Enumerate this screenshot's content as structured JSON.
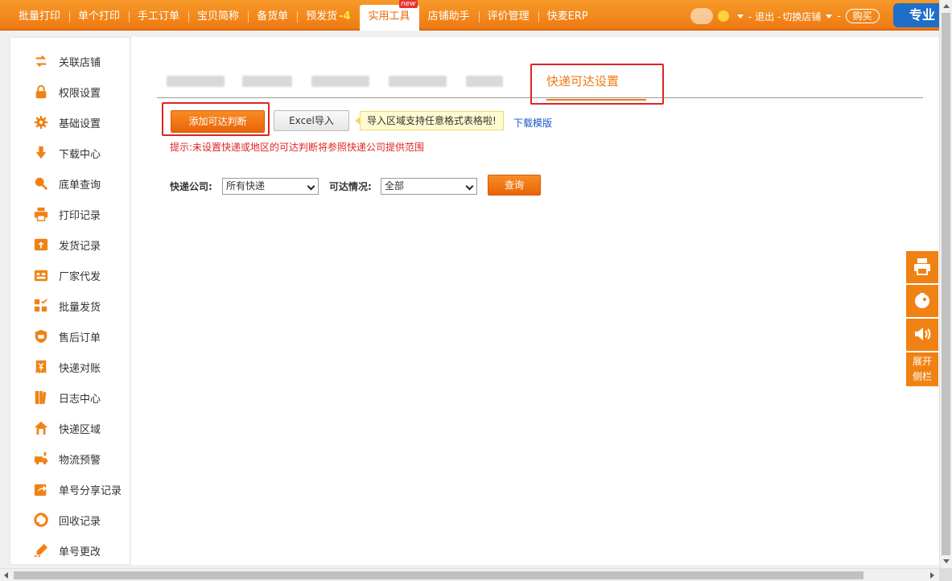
{
  "nav": {
    "items": [
      "批量打印",
      "单个打印",
      "手工订单",
      "宝贝简称",
      "备货单",
      "预发货",
      "实用工具",
      "店铺助手",
      "评价管理",
      "快麦ERP"
    ],
    "badge": "-4",
    "new_label": "new",
    "active_index": 6
  },
  "user": {
    "logout": "- 退出 -",
    "switch_shop": "切换店铺",
    "sep": "-",
    "buy": "购买",
    "pro": "专业"
  },
  "sidebar": {
    "items": [
      {
        "label": "关联店铺",
        "icon": "swap-icon"
      },
      {
        "label": "权限设置",
        "icon": "lock-icon"
      },
      {
        "label": "基础设置",
        "icon": "gear-icon"
      },
      {
        "label": "下载中心",
        "icon": "download-icon"
      },
      {
        "label": "底单查询",
        "icon": "search-icon"
      },
      {
        "label": "打印记录",
        "icon": "printer-icon"
      },
      {
        "label": "发货记录",
        "icon": "upload-box-icon"
      },
      {
        "label": "厂家代发",
        "icon": "factory-icon"
      },
      {
        "label": "批量发货",
        "icon": "grid-check-icon"
      },
      {
        "label": "售后订单",
        "icon": "aftersale-shield-icon"
      },
      {
        "label": "快递对账",
        "icon": "yen-doc-icon"
      },
      {
        "label": "日志中心",
        "icon": "book-icon"
      },
      {
        "label": "快递区域",
        "icon": "house-icon"
      },
      {
        "label": "物流预警",
        "icon": "truck-alert-icon"
      },
      {
        "label": "单号分享记录",
        "icon": "share-icon"
      },
      {
        "label": "回收记录",
        "icon": "recycle-icon"
      },
      {
        "label": "单号更改",
        "icon": "pen-icon"
      }
    ]
  },
  "main": {
    "active_tab": "快递可达设置",
    "add_button": "添加可达判断",
    "excel_button": "Excel导入",
    "import_tip": "导入区域支持任意格式表格啦!",
    "download_template": "下载模版",
    "hint": "提示:未设置快递或地区的可达判断将参照快递公司提供范围",
    "filter": {
      "company_label": "快递公司:",
      "company_value": "所有快递",
      "status_label": "可达情况:",
      "status_value": "全部",
      "query_button": "查询"
    }
  },
  "floatbar": {
    "expand_line1": "展开",
    "expand_line2": "侧栏"
  },
  "colors": {
    "accent": "#ee7a12",
    "highlight_box": "#e02424",
    "link": "#1a55c8"
  }
}
